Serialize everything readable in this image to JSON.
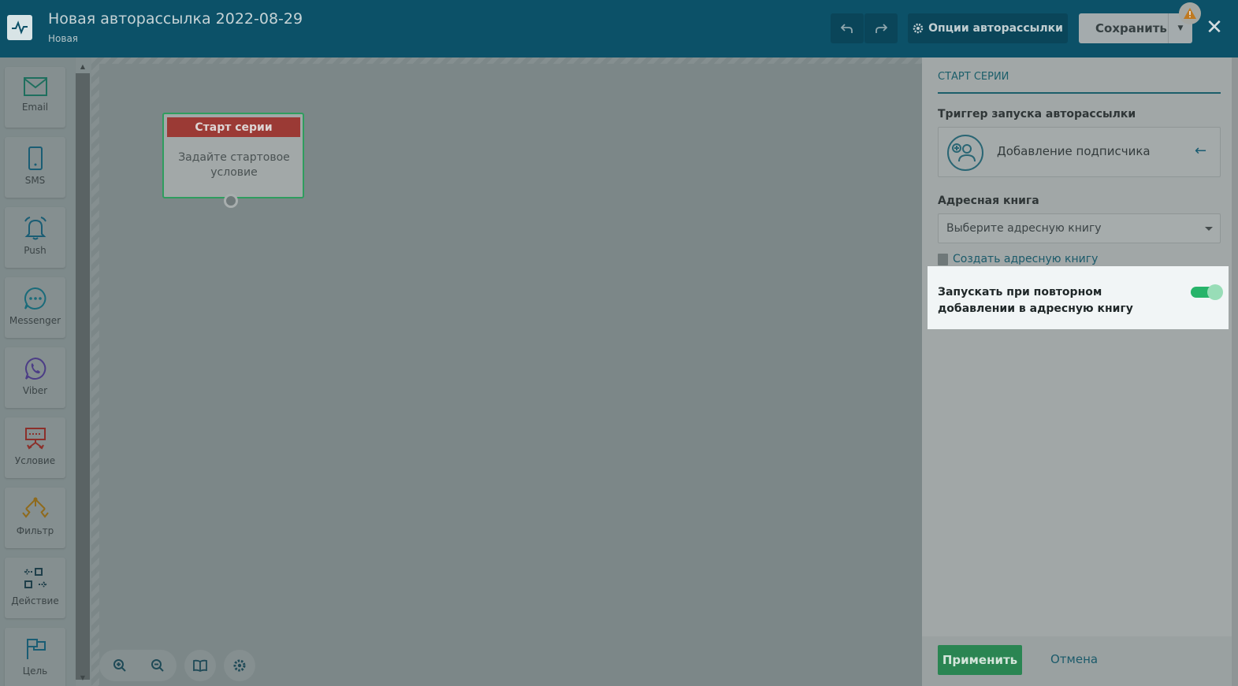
{
  "header": {
    "title": "Новая авторассылка 2022-08-29",
    "subtitle": "Новая",
    "options_label": "Опции авторассылки",
    "save_label": "Сохранить"
  },
  "toolbar": {
    "items": [
      {
        "label": "Email",
        "icon": "email-icon"
      },
      {
        "label": "SMS",
        "icon": "phone-icon"
      },
      {
        "label": "Push",
        "icon": "bell-icon"
      },
      {
        "label": "Messenger",
        "icon": "chat-icon"
      },
      {
        "label": "Viber",
        "icon": "viber-icon"
      },
      {
        "label": "Условие",
        "icon": "condition-icon"
      },
      {
        "label": "Фильтр",
        "icon": "filter-icon"
      },
      {
        "label": "Действие",
        "icon": "action-icon"
      },
      {
        "label": "Цель",
        "icon": "flag-icon"
      }
    ]
  },
  "canvas": {
    "node": {
      "title": "Старт серии",
      "body": "Задайте стартовое условие"
    }
  },
  "panel": {
    "tab": "СТАРТ СЕРИИ",
    "trigger_label": "Триггер запуска авторассылки",
    "trigger_value": "Добавление подписчика",
    "book_label": "Адресная книга",
    "book_placeholder": "Выберите адресную книгу",
    "create_link": "Создать адресную книгу",
    "toggle_label": "Запускать при повторном добавлении в адресную книгу",
    "toggle_on": true,
    "apply_label": "Применить",
    "cancel_label": "Отмена"
  },
  "colors": {
    "header": "#0c5168",
    "accent_green": "#27b46a",
    "node_head": "#9b3a35",
    "link": "#1b5a6a"
  }
}
